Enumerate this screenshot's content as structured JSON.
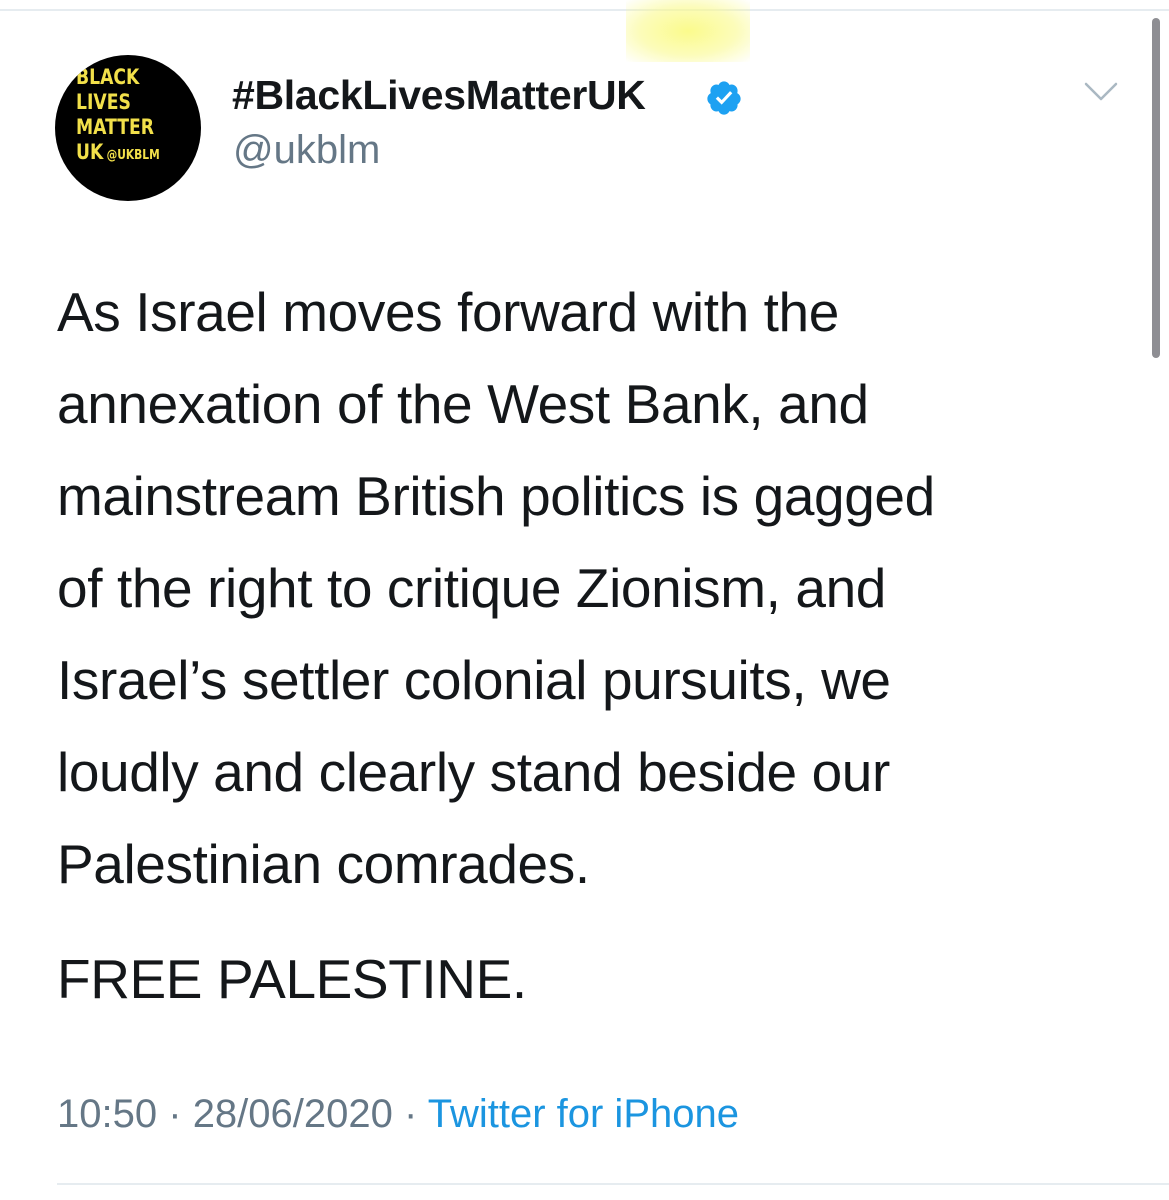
{
  "colors": {
    "verified_blue": "#1da1f2",
    "link_blue": "#1b95e0",
    "secondary_gray": "#657786",
    "text_dark": "#14171a",
    "avatar_bg": "#000000",
    "avatar_text": "#f2e04a"
  },
  "tweet": {
    "avatar": {
      "icon": "avatar-logo",
      "lines": [
        "BLACK",
        "LIVES",
        "MATTER",
        "UK"
      ],
      "small_text": "@UKBLM"
    },
    "author": {
      "display_name": "#BlackLivesMatterUK",
      "handle": "@ukblm",
      "verified_icon": "verified-badge-icon"
    },
    "menu_icon": "chevron-down-icon",
    "body_lines": [
      "As Israel moves forward with the",
      "annexation of the West Bank, and",
      "mainstream British politics is gagged",
      "of the right to critique Zionism, and",
      "Israel’s settler colonial pursuits, we",
      "loudly and clearly stand beside our",
      "Palestinian comrades."
    ],
    "closing": "FREE PALESTINE.",
    "meta": {
      "time": "10:50",
      "separator": "·",
      "date": "28/06/2020",
      "source": "Twitter for iPhone"
    }
  }
}
